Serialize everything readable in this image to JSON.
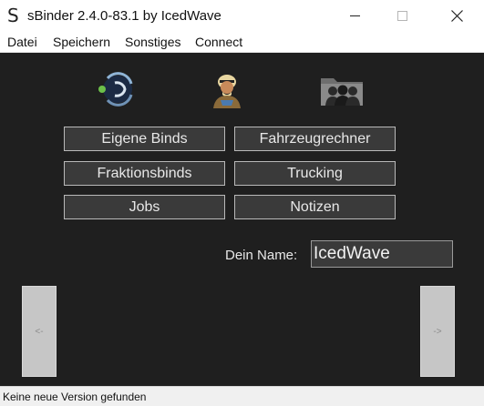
{
  "window": {
    "title": "sBinder 2.4.0-83.1 by IcedWave",
    "app_icon": "S"
  },
  "menu": [
    "Datei",
    "Speichern",
    "Sonstiges",
    "Connect"
  ],
  "icons": [
    "teamspeak-icon",
    "person-avatar-icon",
    "group-folder-icon"
  ],
  "buttons": {
    "eigene_binds": "Eigene Binds",
    "fahrzeugrechner": "Fahrzeugrechner",
    "fraktionsbinds": "Fraktionsbinds",
    "trucking": "Trucking",
    "jobs": "Jobs",
    "notizen": "Notizen"
  },
  "name": {
    "label": "Dein Name:",
    "value": "IcedWave"
  },
  "nav": {
    "prev": "<-",
    "next": "->"
  },
  "status": "Keine neue Version gefunden",
  "colors": {
    "background": "#1f1f1f",
    "button": "#3a3a3a",
    "button_border": "#b9b9b9"
  }
}
